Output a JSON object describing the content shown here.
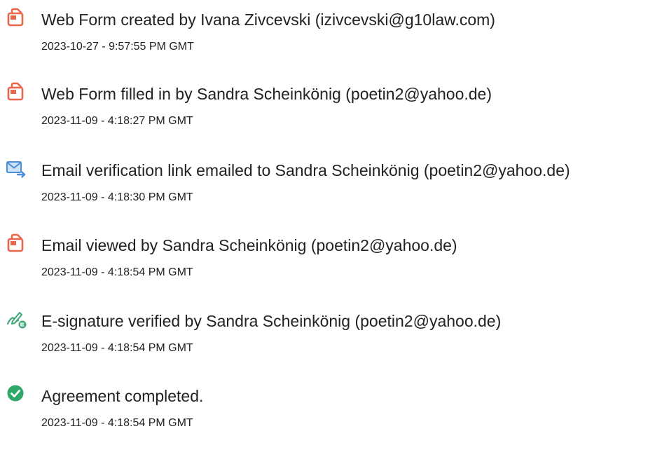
{
  "events": [
    {
      "icon": "web-form-icon",
      "title": "Web Form created by Ivana Zivcevski (izivcevski@g10law.com)",
      "timestamp": "2023-10-27 - 9:57:55 PM GMT"
    },
    {
      "icon": "web-form-icon",
      "title": "Web Form filled in by Sandra Scheinkönig (poetin2@yahoo.de)",
      "timestamp": "2023-11-09 - 4:18:27 PM GMT"
    },
    {
      "icon": "email-sent-icon",
      "title": "Email verification link emailed to Sandra Scheinkönig (poetin2@yahoo.de)",
      "timestamp": "2023-11-09 - 4:18:30 PM GMT"
    },
    {
      "icon": "web-form-icon",
      "title": "Email viewed by Sandra Scheinkönig (poetin2@yahoo.de)",
      "timestamp": "2023-11-09 - 4:18:54 PM GMT"
    },
    {
      "icon": "e-signature-icon",
      "title": "E-signature verified by Sandra Scheinkönig (poetin2@yahoo.de)",
      "timestamp": "2023-11-09 - 4:18:54 PM GMT"
    },
    {
      "icon": "check-circle-icon",
      "title": "Agreement completed.",
      "timestamp": "2023-11-09 - 4:18:54 PM GMT"
    }
  ],
  "colors": {
    "form_icon": "#E8664A",
    "email_icon": "#4A8FD8",
    "signature_icon": "#3FA877",
    "check_icon": "#2DA866",
    "text": "#222222"
  }
}
